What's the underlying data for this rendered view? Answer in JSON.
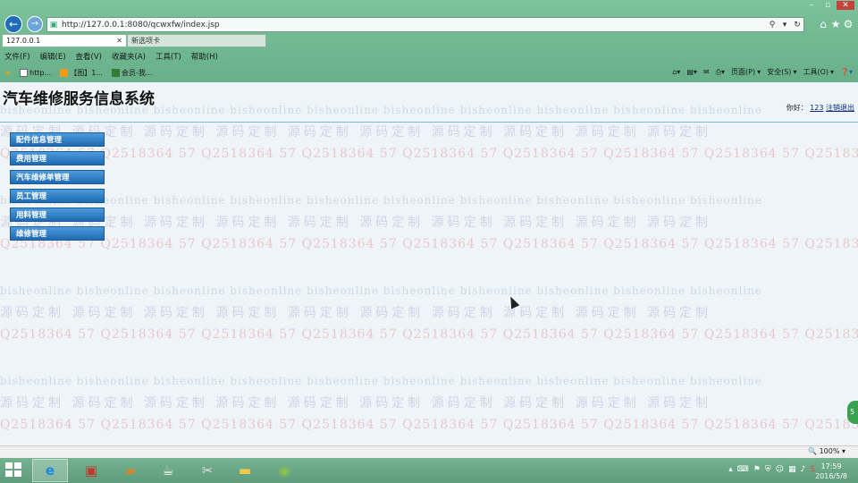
{
  "browser": {
    "url": "http://127.0.0.1:8080/qcwxfw/index.jsp",
    "tabs": [
      {
        "label": "127.0.0.1"
      },
      {
        "label": "新选项卡"
      }
    ],
    "menu": [
      "文件(F)",
      "编辑(E)",
      "查看(V)",
      "收藏夹(A)",
      "工具(T)",
      "帮助(H)"
    ],
    "favorites": [
      {
        "label": "http..."
      },
      {
        "label": "【图】1..."
      },
      {
        "label": "会员-我..."
      }
    ],
    "command_bar": [
      "页面(P)",
      "安全(S)",
      "工具(O)"
    ],
    "zoom": "100%"
  },
  "page": {
    "title": "汽车维修服务信息系统",
    "welcome": {
      "prefix": "你好：",
      "username": "123",
      "logout": "注销退出"
    },
    "menu": [
      {
        "label": "配件信息管理"
      },
      {
        "label": "费用管理"
      },
      {
        "label": "汽车维修单管理"
      },
      {
        "label": "员工管理"
      },
      {
        "label": "用料管理"
      },
      {
        "label": "维修管理"
      }
    ]
  },
  "watermarks": {
    "a": "bisheonline",
    "b": "源码定制",
    "c": "Q2518364 57"
  },
  "taskbar": {
    "clock_time": "17:59",
    "clock_date": "2016/5/8"
  },
  "colors": {
    "menu_button": "#2b7fc8",
    "chrome": "#6fae8c"
  }
}
